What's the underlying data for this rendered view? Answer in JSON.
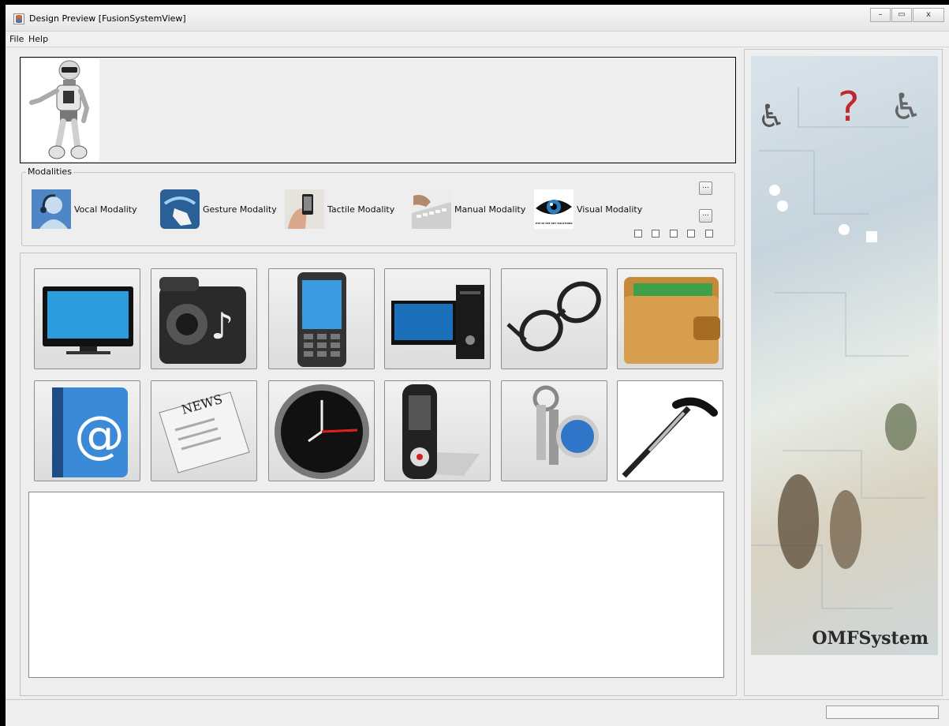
{
  "window": {
    "title": "Design Preview [FusionSystemView]"
  },
  "menu": [
    "File",
    "Help"
  ],
  "modalities": {
    "label": "Modalities",
    "items": [
      {
        "label": "Vocal Modality",
        "icon": "headset-person-icon"
      },
      {
        "label": "Gesture Modality",
        "icon": "hand-swipe-icon"
      },
      {
        "label": "Tactile Modality",
        "icon": "hand-phone-icon"
      },
      {
        "label": "Manual Modality",
        "icon": "hand-keyboard-icon"
      },
      {
        "label": "Visual Modality",
        "icon": "eye-icon"
      }
    ],
    "eye_caption": "EYE IN THE SKY SOLUTIONS",
    "buttons": [
      "...",
      "..."
    ],
    "checkbox_count": 5
  },
  "devices": [
    {
      "icon": "tv-icon"
    },
    {
      "icon": "music-speaker-folder-icon"
    },
    {
      "icon": "mobile-phone-icon"
    },
    {
      "icon": "desktop-computer-icon"
    },
    {
      "icon": "eyeglasses-icon"
    },
    {
      "icon": "wallet-icon"
    },
    {
      "icon": "address-book-icon",
      "text": "@"
    },
    {
      "icon": "newspaper-icon",
      "text": "NEWS"
    },
    {
      "icon": "clock-icon"
    },
    {
      "icon": "remote-control-icon"
    },
    {
      "icon": "keys-icon"
    },
    {
      "icon": "walking-cane-icon"
    }
  ],
  "poster": {
    "title": "OMFSystem"
  },
  "window_controls": {
    "minimize": "–",
    "maximize": "▭",
    "close": "x"
  }
}
